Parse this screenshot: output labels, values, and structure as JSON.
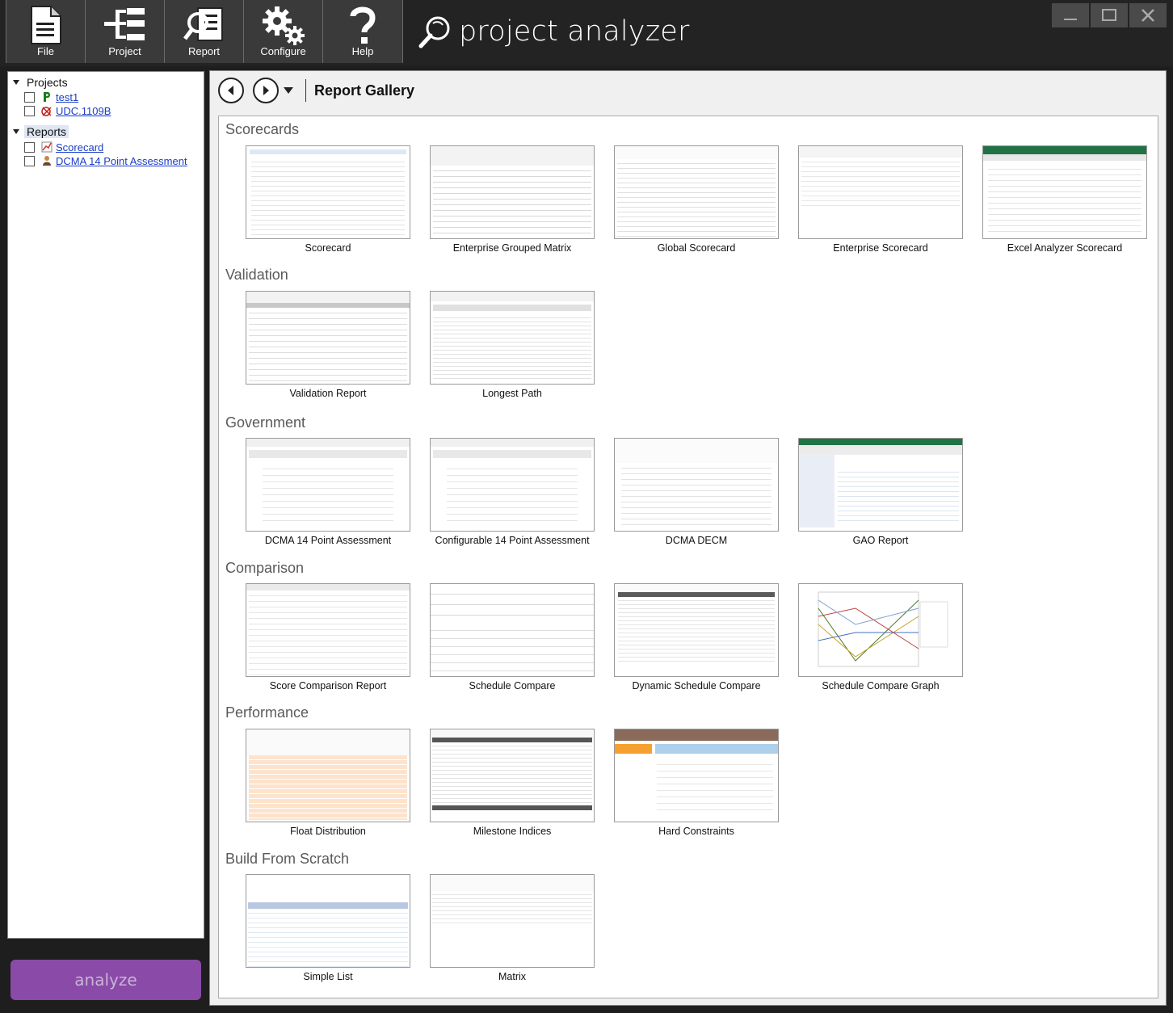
{
  "toolbar": {
    "buttons": [
      {
        "label": "File",
        "icon": "document-icon"
      },
      {
        "label": "Project",
        "icon": "hierarchy-icon"
      },
      {
        "label": "Report",
        "icon": "report-search-icon"
      },
      {
        "label": "Configure",
        "icon": "gears-icon"
      },
      {
        "label": "Help",
        "icon": "question-icon"
      }
    ],
    "app_name": "project analyzer"
  },
  "tree": {
    "projects_label": "Projects",
    "projects": [
      {
        "name": "test1",
        "icon": "project-p-icon"
      },
      {
        "name": "UDC.1109B",
        "icon": "project-error-icon"
      }
    ],
    "reports_label": "Reports",
    "reports": [
      {
        "name": "Scorecard",
        "icon": "scorecard-icon"
      },
      {
        "name": "DCMA 14 Point Assessment",
        "icon": "person-icon"
      }
    ]
  },
  "analyze_label": "analyze",
  "gallery": {
    "title": "Report Gallery",
    "sections": [
      {
        "title": "Scorecards",
        "items": [
          "Scorecard",
          "Enterprise Grouped Matrix",
          "Global Scorecard",
          "Enterprise Scorecard",
          "Excel Analyzer Scorecard"
        ]
      },
      {
        "title": "Validation",
        "items": [
          "Validation Report",
          "Longest Path"
        ]
      },
      {
        "title": "Government",
        "items": [
          "DCMA 14 Point Assessment",
          "Configurable 14 Point Assessment",
          "DCMA DECM",
          "GAO Report"
        ]
      },
      {
        "title": "Comparison",
        "items": [
          "Score Comparison Report",
          "Schedule Compare",
          "Dynamic Schedule Compare",
          "Schedule Compare Graph"
        ]
      },
      {
        "title": "Performance",
        "items": [
          "Float Distribution",
          "Milestone Indices",
          "Hard Constraints"
        ]
      },
      {
        "title": "Build From Scratch",
        "items": [
          "Simple List",
          "Matrix"
        ]
      }
    ]
  }
}
